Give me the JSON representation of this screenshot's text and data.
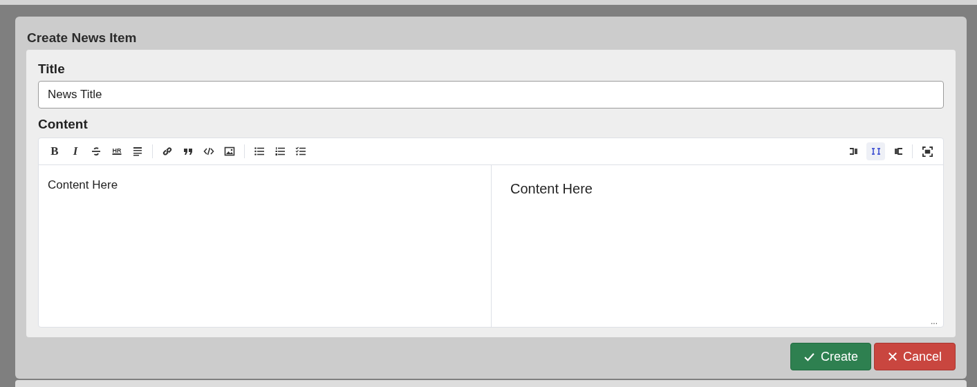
{
  "dialog": {
    "title": "Create News Item"
  },
  "fields": {
    "title_label": "Title",
    "title_value": "News Title",
    "content_label": "Content"
  },
  "toolbar": [
    {
      "kind": "bold",
      "label": "B"
    },
    {
      "kind": "italic",
      "label": "I"
    },
    {
      "kind": "strike"
    },
    {
      "kind": "hr",
      "label": "HR"
    },
    {
      "kind": "heading"
    },
    {
      "kind": "separator"
    },
    {
      "kind": "link"
    },
    {
      "kind": "quote"
    },
    {
      "kind": "code"
    },
    {
      "kind": "image"
    },
    {
      "kind": "separator"
    },
    {
      "kind": "ul"
    },
    {
      "kind": "ol"
    },
    {
      "kind": "tasks"
    }
  ],
  "view_buttons": [
    {
      "kind": "edit",
      "selected": false
    },
    {
      "kind": "split",
      "selected": true
    },
    {
      "kind": "preview",
      "selected": false
    }
  ],
  "fullscreen": true,
  "editor": {
    "source": "Content Here",
    "preview": "Content Here",
    "resize_handle": "..."
  },
  "buttons": [
    {
      "kind": "create",
      "label": "Create"
    },
    {
      "kind": "cancel",
      "label": "Cancel"
    }
  ]
}
